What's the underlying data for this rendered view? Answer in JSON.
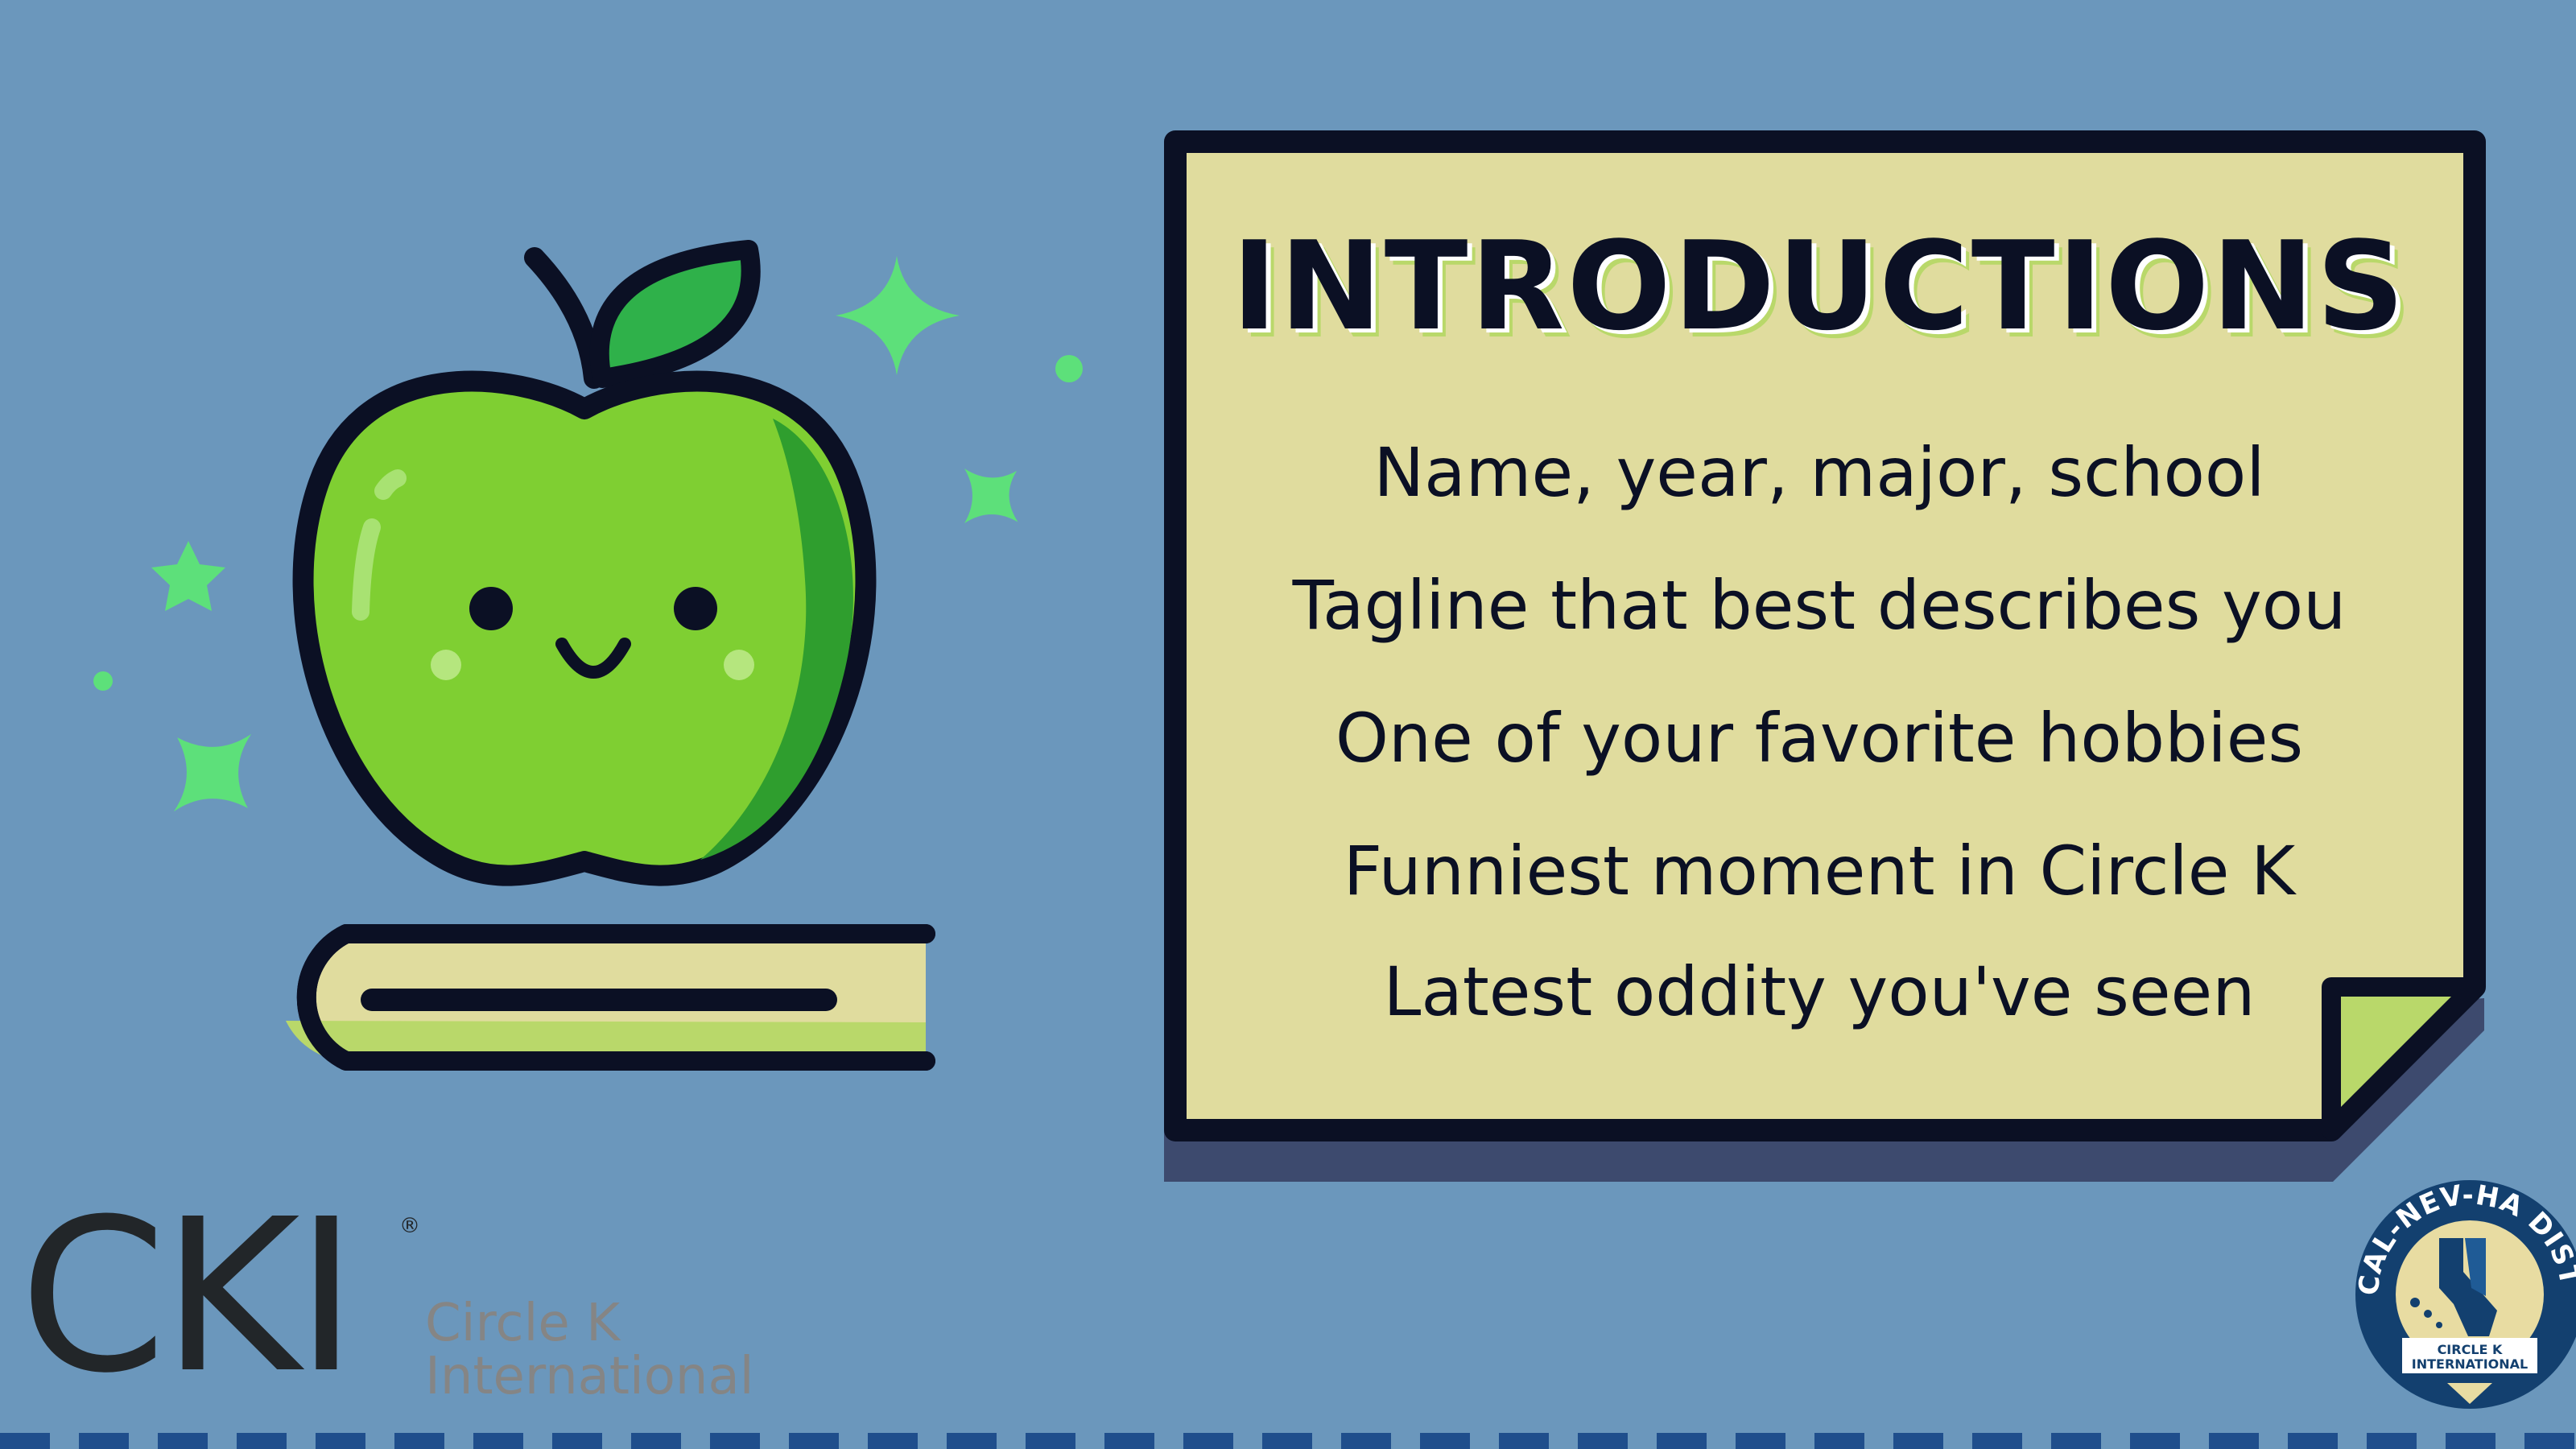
{
  "slide": {
    "title": "INTRODUCTIONS",
    "items": [
      "Name, year, major, school",
      "Tagline that best describes you",
      "One of your favorite hobbies",
      "Funniest moment in Circle K",
      "Latest oddity you've seen"
    ]
  },
  "logo": {
    "letters": "CKI",
    "registered": "®",
    "line1": "Circle K",
    "line2": "International"
  },
  "badge": {
    "top_text": "CAL-NEV-HA DISTRICT",
    "bottom_line1": "CIRCLE K",
    "bottom_line2": "INTERNATIONAL"
  },
  "colors": {
    "background": "#6b97bc",
    "note_paper": "#e0dc9e",
    "apple": "#7fcf32",
    "sparkle": "#5de07a",
    "dark": "#0b1024"
  }
}
